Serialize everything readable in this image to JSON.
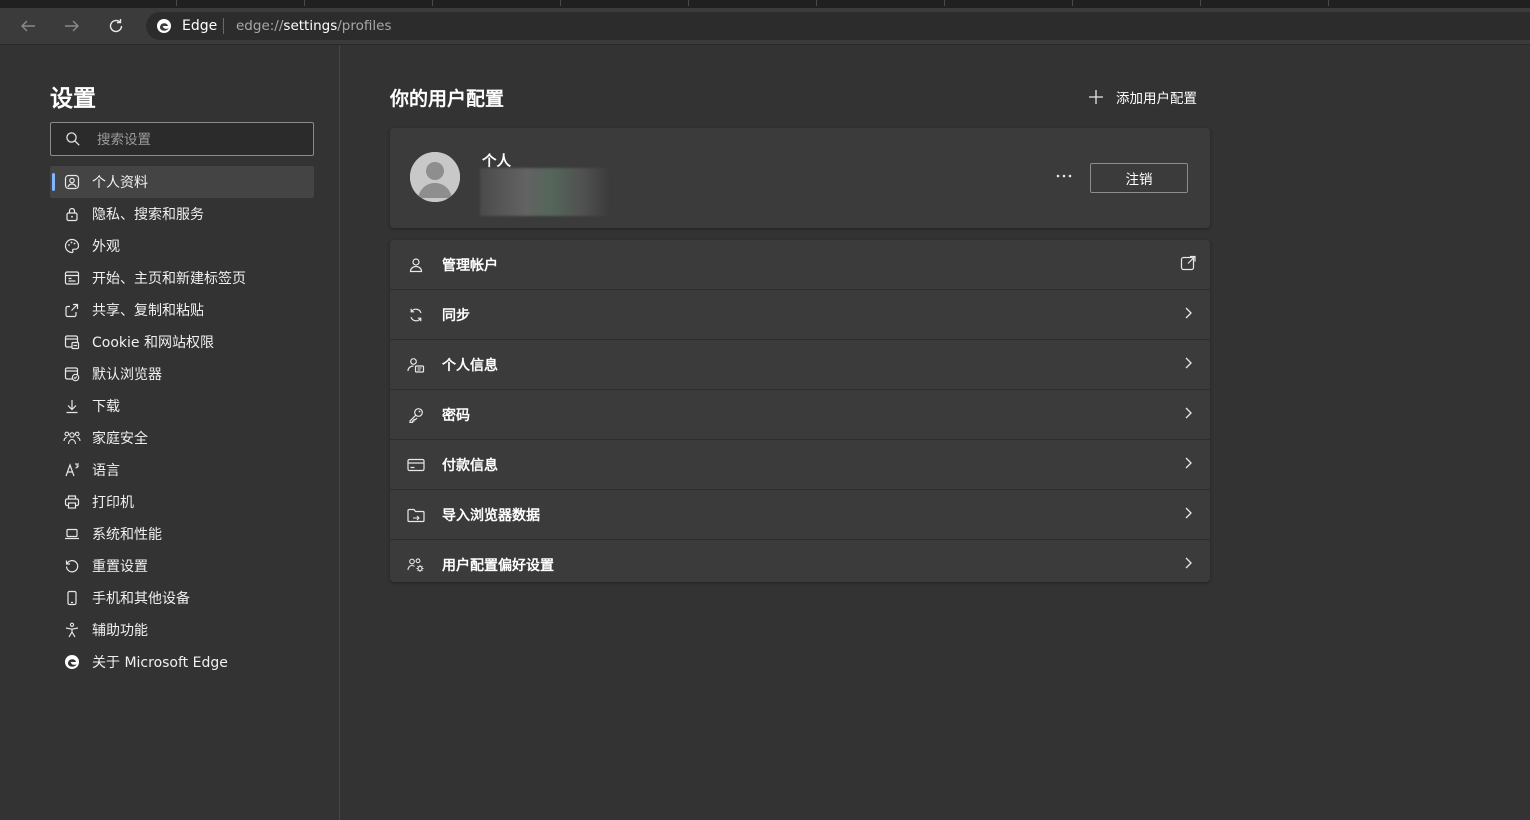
{
  "browser": {
    "site_label": "Edge",
    "url_prefix": "edge://",
    "url_host": "settings",
    "url_path": "/profiles"
  },
  "sidebar": {
    "title": "设置",
    "search_placeholder": "搜索设置",
    "items": [
      {
        "label": "个人资料",
        "icon": "profile-icon",
        "active": true
      },
      {
        "label": "隐私、搜索和服务",
        "icon": "lock-icon"
      },
      {
        "label": "外观",
        "icon": "palette-icon"
      },
      {
        "label": "开始、主页和新建标签页",
        "icon": "home-tab-icon"
      },
      {
        "label": "共享、复制和粘贴",
        "icon": "share-icon"
      },
      {
        "label": "Cookie 和网站权限",
        "icon": "cookie-permissions-icon"
      },
      {
        "label": "默认浏览器",
        "icon": "default-browser-icon"
      },
      {
        "label": "下载",
        "icon": "download-icon"
      },
      {
        "label": "家庭安全",
        "icon": "family-icon"
      },
      {
        "label": "语言",
        "icon": "language-icon"
      },
      {
        "label": "打印机",
        "icon": "printer-icon"
      },
      {
        "label": "系统和性能",
        "icon": "laptop-icon"
      },
      {
        "label": "重置设置",
        "icon": "reset-icon"
      },
      {
        "label": "手机和其他设备",
        "icon": "phone-icon"
      },
      {
        "label": "辅助功能",
        "icon": "accessibility-icon"
      },
      {
        "label": "关于 Microsoft Edge",
        "icon": "edge-logo-icon"
      }
    ]
  },
  "main": {
    "title": "你的用户配置",
    "add_profile_label": "添加用户配置",
    "profile": {
      "name": "个人",
      "sign_out_label": "注销"
    },
    "rows": [
      {
        "label": "管理帐户",
        "icon": "person-icon",
        "trailing": "external-link-icon"
      },
      {
        "label": "同步",
        "icon": "sync-icon",
        "trailing": "chevron-right-icon"
      },
      {
        "label": "个人信息",
        "icon": "personal-info-icon",
        "trailing": "chevron-right-icon"
      },
      {
        "label": "密码",
        "icon": "key-icon",
        "trailing": "chevron-right-icon"
      },
      {
        "label": "付款信息",
        "icon": "card-icon",
        "trailing": "chevron-right-icon"
      },
      {
        "label": "导入浏览器数据",
        "icon": "import-icon",
        "trailing": "chevron-right-icon"
      },
      {
        "label": "用户配置偏好设置",
        "icon": "profile-prefs-icon",
        "trailing": "chevron-right-icon"
      }
    ]
  },
  "colors": {
    "background": "#333333",
    "card": "#3b3b3b",
    "accent": "#7fb6ff"
  }
}
